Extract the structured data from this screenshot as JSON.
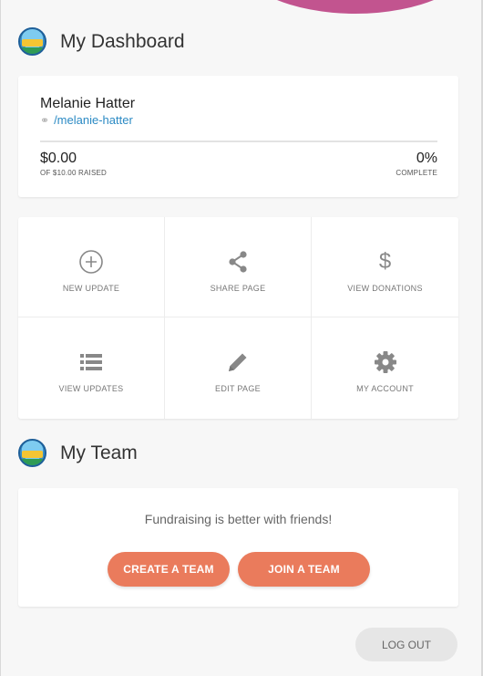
{
  "dashboard": {
    "title": "My Dashboard"
  },
  "profile": {
    "name": "Melanie Hatter",
    "link": "/melanie-hatter",
    "raised_amount": "$0.00",
    "raised_sub": "OF $10.00 RAISED",
    "percent": "0%",
    "percent_sub": "COMPLETE",
    "progress_fraction": 0
  },
  "actions": [
    {
      "label": "NEW UPDATE",
      "icon": "plus-circle-icon"
    },
    {
      "label": "SHARE PAGE",
      "icon": "share-icon"
    },
    {
      "label": "VIEW DONATIONS",
      "icon": "dollar-icon"
    },
    {
      "label": "VIEW UPDATES",
      "icon": "list-icon"
    },
    {
      "label": "EDIT PAGE",
      "icon": "pencil-icon"
    },
    {
      "label": "MY ACCOUNT",
      "icon": "gear-icon"
    }
  ],
  "team": {
    "title": "My Team",
    "message": "Fundraising is better with friends!",
    "create_label": "CREATE A TEAM",
    "join_label": "JOIN A TEAM"
  },
  "logout_label": "LOG OUT",
  "colors": {
    "accent": "#ea7b5c",
    "link": "#2b8ac4",
    "brand_arc": "#c2548f"
  }
}
